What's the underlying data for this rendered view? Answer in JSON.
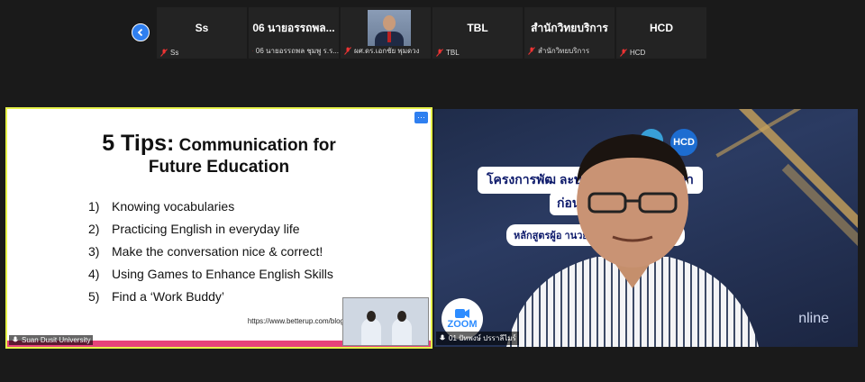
{
  "top_strip": {
    "participants": [
      {
        "big_label": "Ss",
        "caption": "Ss"
      },
      {
        "big_label": "06 นายอรรถพล...",
        "caption": "06 นายอรรถพล ชุมพู ร.ร..."
      },
      {
        "big_label": "",
        "caption": "ผศ.ดร.เอกชัย พุมดวง",
        "has_photo": true
      },
      {
        "big_label": "TBL",
        "caption": "TBL"
      },
      {
        "big_label": "สำนักวิทยบริการ",
        "caption": "สำนักวิทยบริการ"
      },
      {
        "big_label": "HCD",
        "caption": "HCD"
      }
    ]
  },
  "shared_screen": {
    "owner": "Suan Dusit University",
    "slide": {
      "title_num": "5 Tips:",
      "title_rest": "Communication for",
      "title_line2": "Future Education",
      "tips": [
        {
          "n": "1)",
          "text": "Knowing vocabularies"
        },
        {
          "n": "2)",
          "text": "Practicing English in everyday life"
        },
        {
          "n": "3)",
          "text": "Make the conversation nice & correct!"
        },
        {
          "n": "4)",
          "text": "Using Games to Enhance English Skills"
        },
        {
          "n": "5)",
          "text": "Find a ‘Work Buddy’"
        }
      ],
      "url": "https://www.betterup.com/blog"
    }
  },
  "speaker_video": {
    "name": "01 ปัทพงษ์ ปรราลีไมร์",
    "banner_line1": "โครงการพัฒ             ละบุคลากรทางการศึกษา",
    "banner_line2": "ก่อนเ            นเป็นวิทยฐานะ",
    "banner_line3": "หลักสูตรผู้อ               านวยการชำนาญการพิเศษ",
    "logo_text": "HCD",
    "zoom_text": "ZOOM",
    "online_text": "nline"
  }
}
